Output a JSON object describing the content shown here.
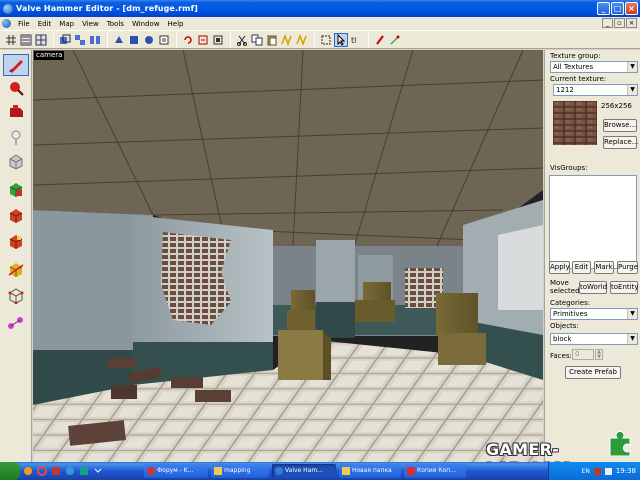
{
  "window": {
    "title": "Valve Hammer Editor - [dm_refuge.rmf]",
    "minimize": "_",
    "maximize": "□",
    "close": "×"
  },
  "menu": [
    "File",
    "Edit",
    "Map",
    "View",
    "Tools",
    "Window",
    "Help"
  ],
  "viewport": {
    "label": "camera"
  },
  "right_panel": {
    "texture_group_label": "Texture group:",
    "texture_group_value": "All Textures",
    "current_texture_label": "Current texture:",
    "current_texture_value": "1212",
    "texture_size": "256x256",
    "browse_button": "Browse...",
    "replace_button": "Replace...",
    "visgroups_label": "VisGroups:",
    "visgroup_buttons": [
      "Apply",
      "Edit",
      "Mark",
      "Purge"
    ],
    "move_selected_label_1": "Move",
    "move_selected_label_2": "selected:",
    "to_world_button": "toWorld",
    "to_entity_button": "toEntity",
    "categories_label": "Categories:",
    "categories_value": "Primitives",
    "objects_label": "Objects:",
    "objects_value": "block",
    "faces_label": "Faces:",
    "faces_value": "0",
    "create_prefab_button": "Create Prefab"
  },
  "taskbar": {
    "tasks": [
      {
        "label": "Форум - K...",
        "color": "#d9302c"
      },
      {
        "label": "mapping",
        "color": "#f2c94c"
      },
      {
        "label": "Valve Ham...",
        "color": "#3a7bd5"
      },
      {
        "label": "Новая папка",
        "color": "#f2c94c"
      },
      {
        "label": "Копия Коп...",
        "color": "#d9302c"
      }
    ],
    "active_task": 2,
    "language": "EN",
    "clock": "19:38"
  },
  "watermark": "GAMER-LAB.COM"
}
